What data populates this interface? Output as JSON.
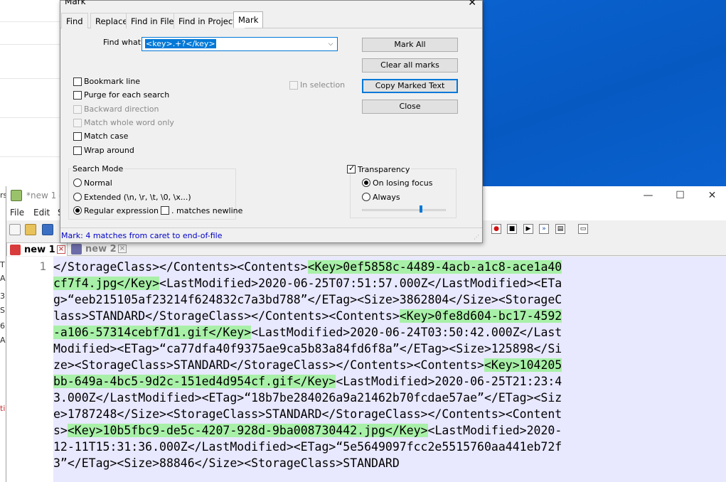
{
  "background": {
    "left_fragments": [
      "rs",
      "T",
      "A",
      "3",
      "S",
      "6",
      "A",
      "ti"
    ]
  },
  "npp": {
    "title": "*new 1 -",
    "menu": [
      "File",
      "Edit",
      "S"
    ],
    "minimize": "—",
    "maximize": "☐",
    "close": "✕",
    "doc_close": "X",
    "tabs": [
      {
        "label": "new 1",
        "active": true
      },
      {
        "label": "new 2",
        "active": false
      }
    ],
    "line_number": "1",
    "code_lines": [
      [
        {
          "t": "</StorageClass></Contents><Contents>"
        },
        {
          "t": "<Key>0ef5858c-4489-4acb-a1c8-ace1a40",
          "hl": true
        }
      ],
      [
        {
          "t": "cf7f4.jpg</Key>",
          "hl": true
        },
        {
          "t": "<LastModified>2020-06-25T07:51:57.000Z</LastModified><ETa"
        }
      ],
      [
        {
          "t": "g>“eeb215105af23214f624832c7a3bd788”</ETag><Size>3862804</Size><StorageC"
        }
      ],
      [
        {
          "t": "lass>STANDARD</StorageClass></Contents><Contents>"
        },
        {
          "t": "<Key>0fe8d604-bc17-4592",
          "hl": true
        }
      ],
      [
        {
          "t": "-a106-57314cebf7d1.gif</Key>",
          "hl": true
        },
        {
          "t": "<LastModified>2020-06-24T03:50:42.000Z</Last"
        }
      ],
      [
        {
          "t": "Modified><ETag>“ca77dfa40f9375ae9ca5b83a84fd6f8a”</ETag><Size>125898</Si"
        }
      ],
      [
        {
          "t": "ze><StorageClass>STANDARD</StorageClass></Contents><Contents>"
        },
        {
          "t": "<Key>104205",
          "hl": true
        }
      ],
      [
        {
          "t": "bb-649a-4bc5-9d2c-151ed4d954cf.gif</Key>",
          "hl": true
        },
        {
          "t": "<LastModified>2020-06-25T21:23:4"
        }
      ],
      [
        {
          "t": "3.000Z</LastModified><ETag>“18b7be284026a9a21462b70fcdae57ae”</ETag><Siz"
        }
      ],
      [
        {
          "t": "e>1787248</Size><StorageClass>STANDARD</StorageClass></Contents><Content"
        }
      ],
      [
        {
          "t": "s>"
        },
        {
          "t": "<Key>10b5fbc9-de5c-4207-928d-9ba008730442.jpg</Key>",
          "hl": true
        },
        {
          "t": "<LastModified>2020-"
        }
      ],
      [
        {
          "t": "12-11T15:31:36.000Z</LastModified><ETag>“5e5649097fcc2e5515760aa441eb72f"
        }
      ],
      [
        {
          "t": "3”</ETag><Size>88846</Size><StorageClass>STANDARD"
        }
      ]
    ]
  },
  "dialog": {
    "title": "Mark",
    "close_glyph": "✕",
    "tabs": [
      "Find",
      "Replace",
      "Find in Files",
      "Find in Projects",
      "Mark"
    ],
    "active_tab": "Mark",
    "find_what_label": "Find what :",
    "find_what_value": "<key>.+?</key>",
    "buttons": {
      "mark_all": "Mark All",
      "clear_all": "Clear all marks",
      "copy_marked": "Copy Marked Text",
      "close": "Close"
    },
    "options": {
      "bookmark_line": "Bookmark line",
      "purge": "Purge for each search",
      "backward": "Backward direction",
      "whole_word": "Match whole word only",
      "match_case": "Match case",
      "wrap_around": "Wrap around",
      "in_selection": "In selection"
    },
    "search_mode": {
      "title": "Search Mode",
      "normal": "Normal",
      "extended": "Extended (\\n, \\r, \\t, \\0, \\x...)",
      "regex": "Regular expression",
      "matches_newline": ". matches newline",
      "selected": "regex"
    },
    "transparency": {
      "title": "Transparency",
      "checked": true,
      "on_losing_focus": "On losing focus",
      "always": "Always",
      "selected": "on_losing_focus",
      "level": 0.68
    },
    "status": "Mark: 4 matches from caret to end-of-file"
  }
}
